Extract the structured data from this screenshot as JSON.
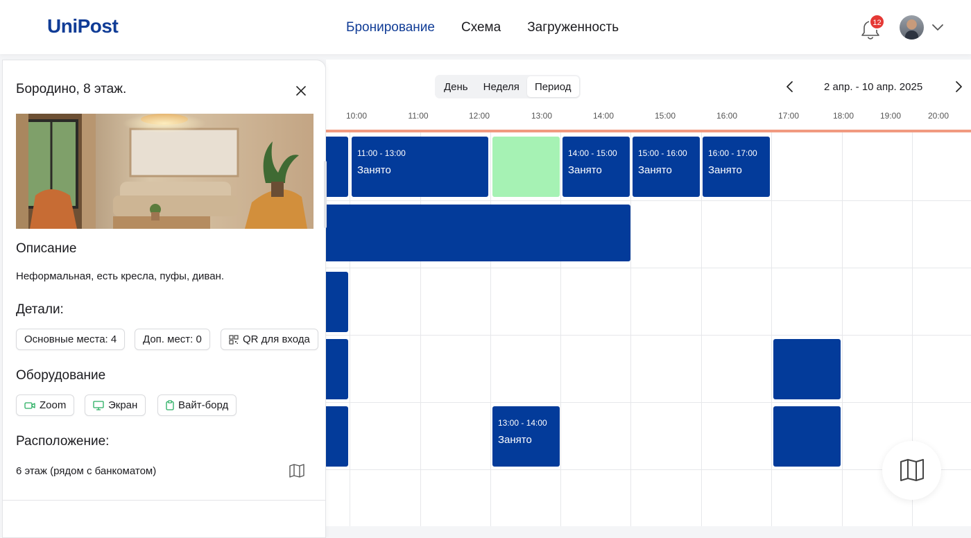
{
  "header": {
    "logo": "UniPost",
    "nav": [
      "Бронирование",
      "Схема",
      "Загруженность"
    ],
    "active_nav": "Бронирование",
    "notifications_count": "12"
  },
  "icons": {
    "bell": "bell-icon",
    "avatar": "user-avatar",
    "dropdown": "chevron-down-icon",
    "close": "close-icon",
    "map": "map-icon",
    "qr": "qr-code-icon",
    "video": "video-camera-icon",
    "monitor": "monitor-icon",
    "whiteboard": "clipboard-icon"
  },
  "colors": {
    "brand": "#103c96",
    "booked": "#033b9a",
    "free": "#a6f2b4",
    "now_line": "#f19a80",
    "badge": "#e53935",
    "equipment_icon": "#27ae60"
  },
  "schedule": {
    "view_options": [
      "День",
      "Неделя",
      "Период"
    ],
    "selected_view": "Период",
    "date_range": "2 апр. - 10 апр. 2025",
    "hours": [
      "10:00",
      "11:00",
      "12:00",
      "13:00",
      "14:00",
      "15:00",
      "16:00",
      "17:00",
      "18:00",
      "19:00",
      "20:00"
    ],
    "row0": {
      "cut_time": "0",
      "b1_time": "11:00 - 13:00",
      "b1_status": "Занято",
      "b2_time": "14:00 - 15:00",
      "b2_status": "Занято",
      "b3_time": "15:00 - 16:00",
      "b3_status": "Занято",
      "b4_time": "16:00 - 17:00",
      "b4_status": "Занято"
    },
    "row1": {
      "cut_time": "0"
    },
    "row2": {
      "cut_time": "0"
    },
    "row3": {
      "cut_time": "0"
    },
    "row4": {
      "cut_time": "0",
      "b1_time": "13:00 - 14:00",
      "b1_status": "Занято"
    }
  },
  "room": {
    "title": "Бородино, 8 этаж.",
    "description_heading": "Описание",
    "description": "Неформальная, есть кресла, пуфы, диван.",
    "details_heading": "Детали:",
    "details": {
      "main_seats": "Основные места: 4",
      "extra_seats": "Доп. мест: 0",
      "qr": "QR для входа"
    },
    "equipment_heading": "Оборудование",
    "equipment": [
      "Zoom",
      "Экран",
      "Вайт-борд"
    ],
    "location_heading": "Расположение:",
    "location": "6 этаж (рядом с банкоматом)"
  }
}
